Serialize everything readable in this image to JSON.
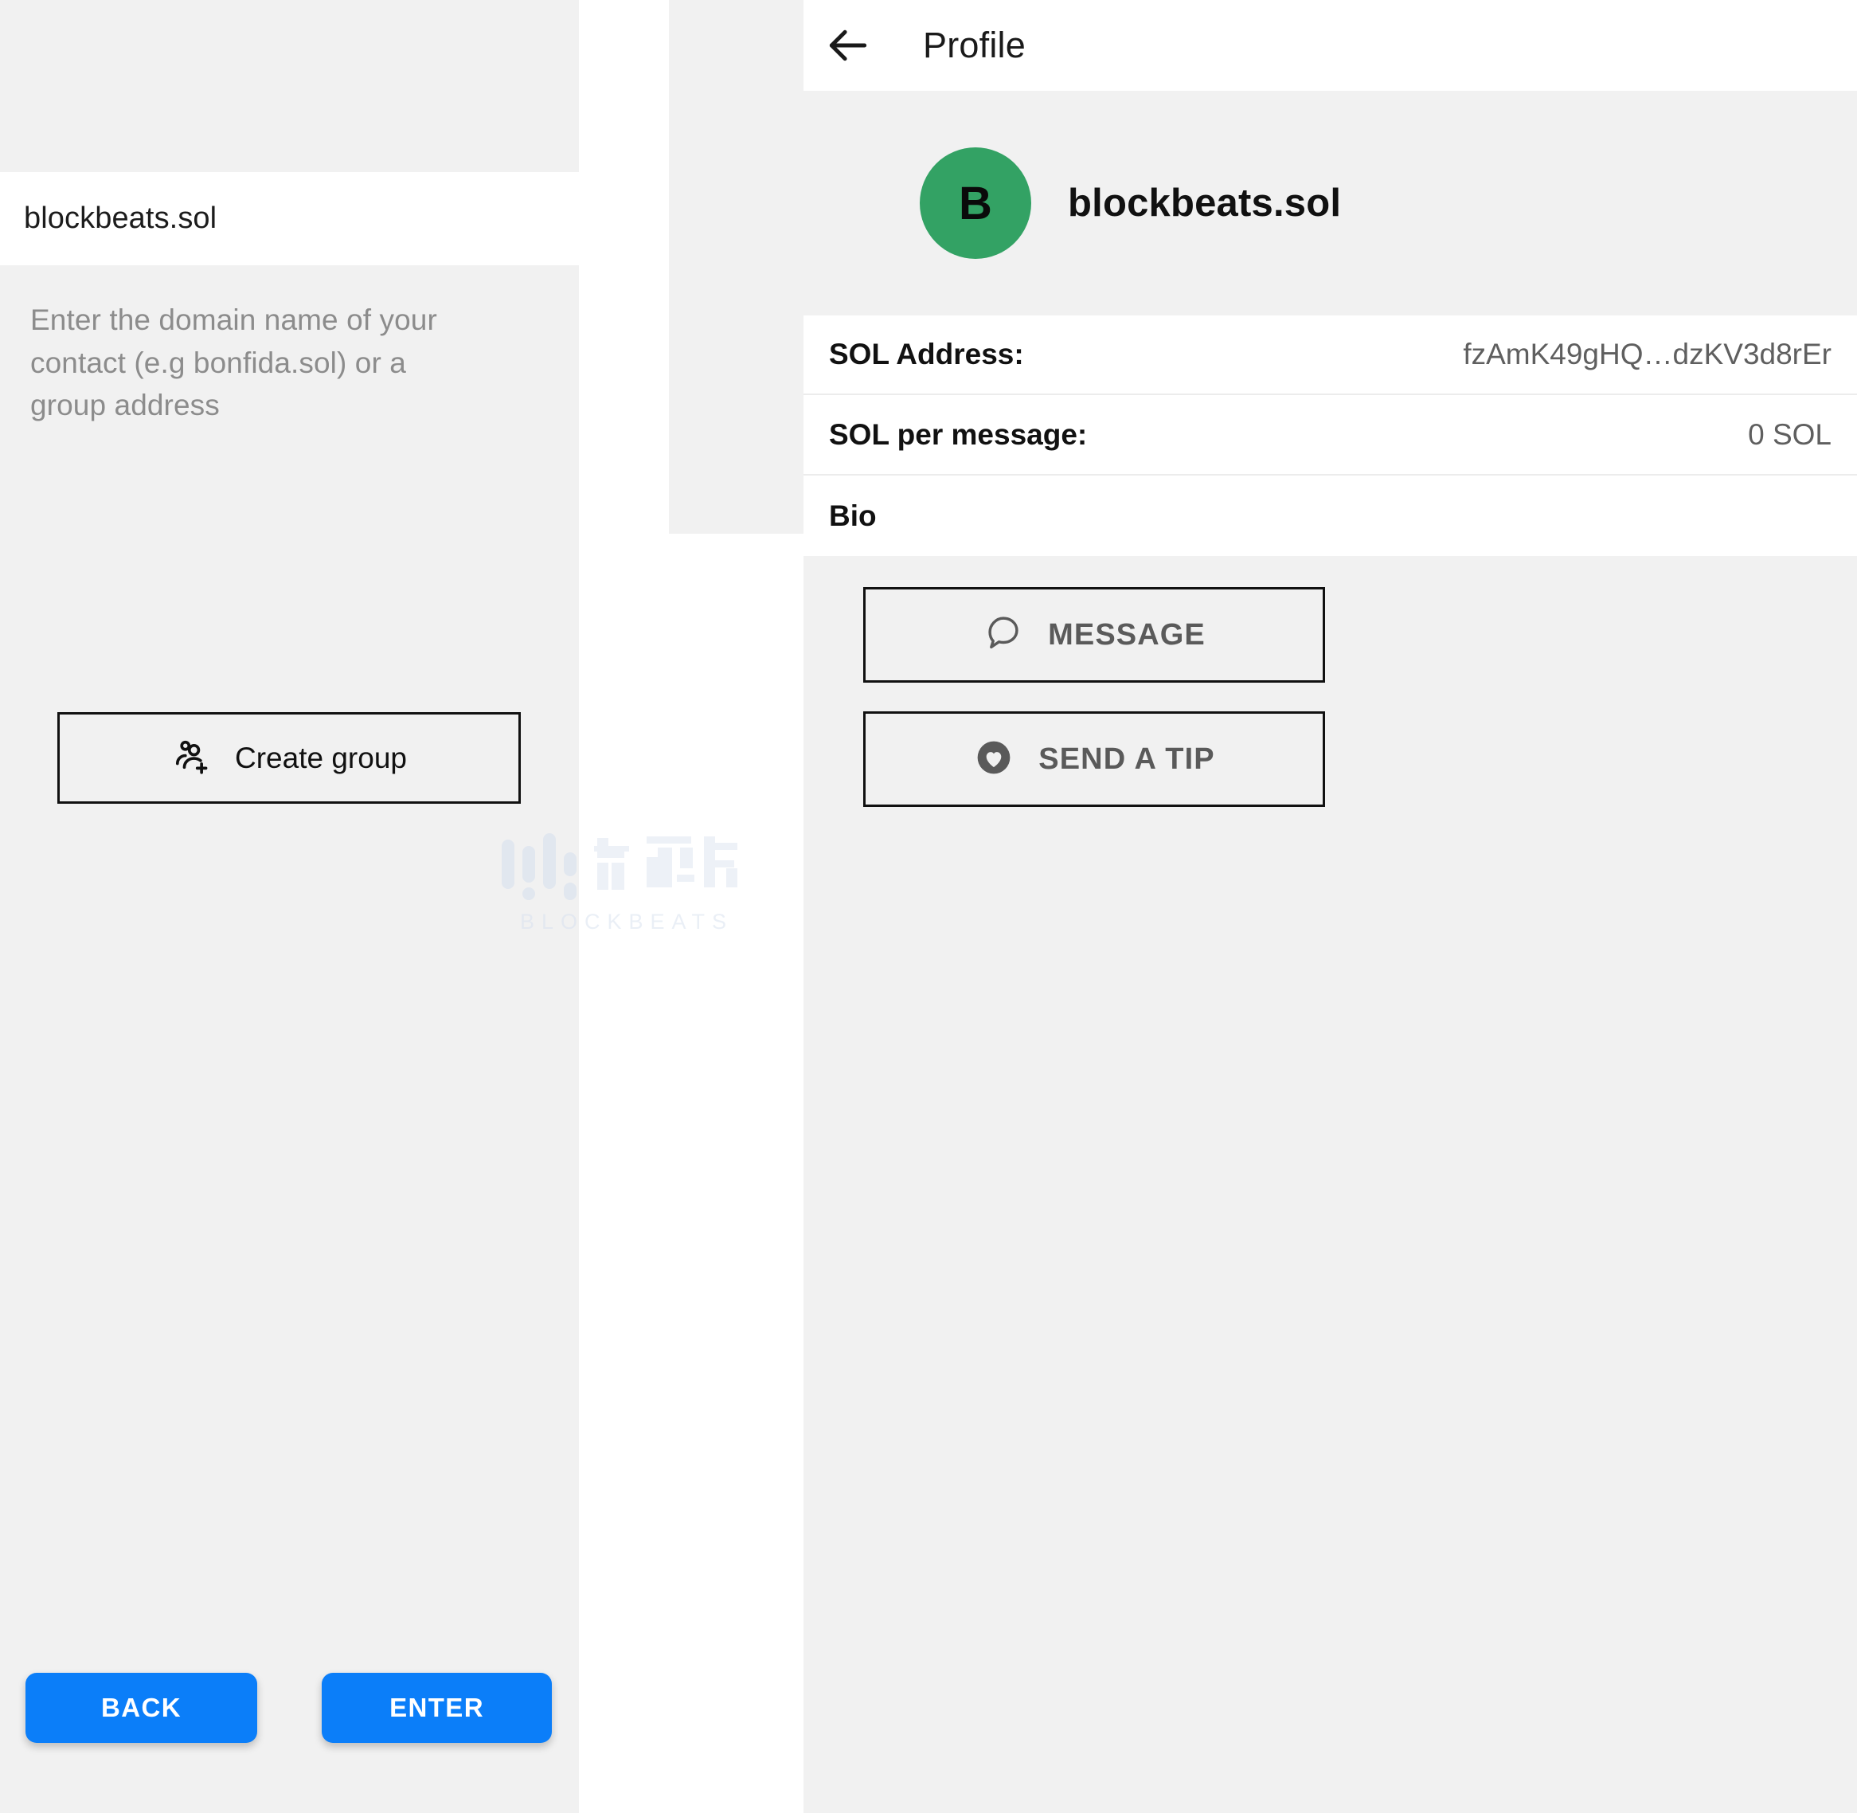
{
  "left": {
    "search_result": {
      "label": "blockbeats.sol"
    },
    "hint": "Enter the domain name of your contact (e.g bonfida.sol) or a group address",
    "create_group": {
      "label": "Create group",
      "icon": "group-add-icon"
    },
    "footer": {
      "back_label": "BACK",
      "enter_label": "ENTER",
      "button_color": "#0b7ef9"
    }
  },
  "right": {
    "appbar": {
      "title": "Profile",
      "back_icon": "arrow-left-icon"
    },
    "profile": {
      "avatar_letter": "B",
      "avatar_color": "#33a264",
      "name": "blockbeats.sol"
    },
    "info_rows": [
      {
        "label": "SOL Address:",
        "value": "fzAmK49gHQ…dzKV3d8rEr"
      },
      {
        "label": "SOL per message:",
        "value": "0 SOL"
      },
      {
        "label": "Bio",
        "value": ""
      }
    ],
    "actions": [
      {
        "label": "MESSAGE",
        "icon": "chat-bubble-icon"
      },
      {
        "label": "SEND A TIP",
        "icon": "heart-circle-icon"
      }
    ]
  },
  "watermark": {
    "text": "BLOCKBEATS"
  }
}
